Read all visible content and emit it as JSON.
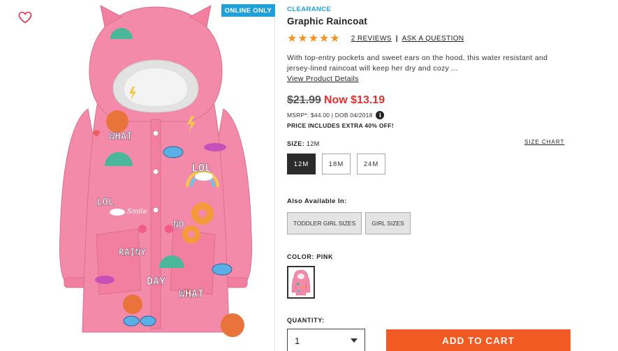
{
  "image": {
    "online_badge": "ONLINE ONLY",
    "favorite_icon": "heart-outline-icon",
    "print_words": [
      "WHAT",
      "LOL",
      "NO",
      "DAY",
      "RAINY",
      "LOL",
      "WHAT",
      "Smile"
    ]
  },
  "product": {
    "tag": "CLEARANCE",
    "title": "Graphic Raincoat",
    "rating_stars": 5,
    "reviews_label": "2 REVIEWS",
    "separator": "|",
    "ask_label": "ASK A QUESTION",
    "description": "With top-entry pockets and sweet ears on the hood, this water resistant and jersey-lined raincoat will keep her dry and cozy ...",
    "view_details_label": "View Product Details",
    "original_price": "$21.99",
    "now_price": "Now $13.19",
    "msrp_line": "MSRP*: $44.00 | DOB 04/2018",
    "info_icon": "i",
    "promo_text": "PRICE INCLUDES EXTRA 40% OFF!"
  },
  "size": {
    "label": "SIZE:",
    "selected_value": "12M",
    "chart_label": "SIZE CHART",
    "options": [
      "12M",
      "18M",
      "24M"
    ]
  },
  "also_available": {
    "label": "Also Available In:",
    "options": [
      "TODDLER GIRL SIZES",
      "GIRL SIZES"
    ]
  },
  "color": {
    "label": "COLOR: PINK",
    "swatch_color": "#f48aa9"
  },
  "quantity": {
    "label": "QUANTITY:",
    "value": "1"
  },
  "add_to_cart_label": "ADD TO CART",
  "colors": {
    "accent_blue": "#1fa0d8",
    "sale_red": "#e42f2f",
    "cart_orange": "#f15a23",
    "star_orange": "#f7941d",
    "coat_pink": "#f48aa9"
  }
}
